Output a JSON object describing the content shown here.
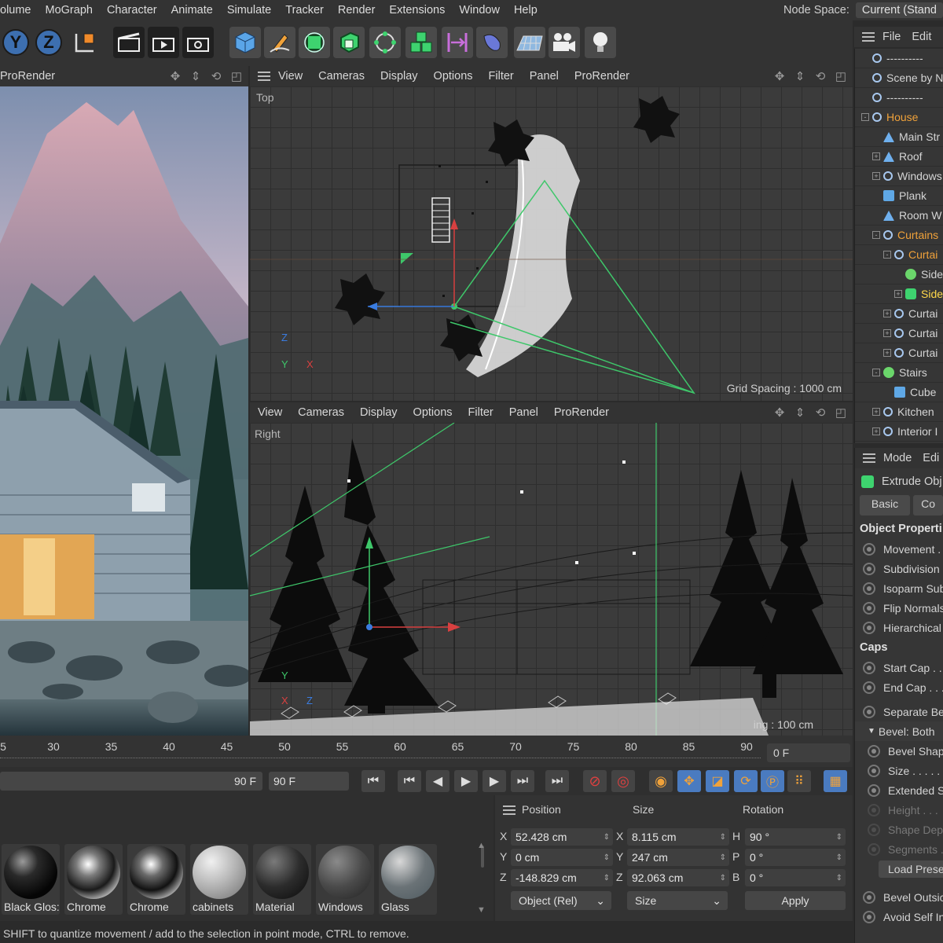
{
  "menu": [
    "olume",
    "MoGraph",
    "Character",
    "Animate",
    "Simulate",
    "Tracker",
    "Render",
    "Extensions",
    "Window",
    "Help"
  ],
  "node_space": {
    "label": "Node Space:",
    "value": "Current (Stand"
  },
  "toolbar": {
    "axis_y": "Y",
    "axis_z": "Z"
  },
  "viewport_render": {
    "header": "ProRender"
  },
  "viewport_top": {
    "menu": [
      "View",
      "Cameras",
      "Display",
      "Options",
      "Filter",
      "Panel",
      "ProRender"
    ],
    "label": "Top",
    "grid_spacing": "Grid Spacing : 1000 cm",
    "axis_z": "Z",
    "axis_y": "Y",
    "axis_x": "X"
  },
  "viewport_right": {
    "menu": [
      "View",
      "Cameras",
      "Display",
      "Options",
      "Filter",
      "Panel",
      "ProRender"
    ],
    "label": "Right",
    "grid_spacing": "ing : 100 cm",
    "axis_y": "Y",
    "axis_x": "X",
    "axis_z": "Z"
  },
  "object_manager": {
    "menu": [
      "File",
      "Edit"
    ],
    "rows": [
      {
        "name": "----------",
        "icon": "null",
        "indent": 0,
        "color": "normal"
      },
      {
        "name": "Scene by N",
        "icon": "null",
        "indent": 0,
        "color": "normal"
      },
      {
        "name": "----------",
        "icon": "null",
        "indent": 0,
        "color": "normal"
      },
      {
        "name": "House",
        "icon": "null",
        "indent": 0,
        "color": "orange",
        "expander": "-"
      },
      {
        "name": "Main Str",
        "icon": "tri",
        "indent": 1,
        "color": "normal"
      },
      {
        "name": "Roof",
        "icon": "tri",
        "indent": 1,
        "color": "normal",
        "expander": "+"
      },
      {
        "name": "Windows",
        "icon": "null",
        "indent": 1,
        "color": "normal",
        "expander": "+"
      },
      {
        "name": "Plank",
        "icon": "cube",
        "indent": 1,
        "color": "normal"
      },
      {
        "name": "Room W",
        "icon": "tri",
        "indent": 1,
        "color": "normal"
      },
      {
        "name": "Curtains",
        "icon": "null",
        "indent": 1,
        "color": "orange",
        "expander": "-"
      },
      {
        "name": "Curtai",
        "icon": "null",
        "indent": 2,
        "color": "orange",
        "expander": "-"
      },
      {
        "name": "Side",
        "icon": "greenstar",
        "indent": 3,
        "color": "normal"
      },
      {
        "name": "Side",
        "icon": "green",
        "indent": 3,
        "color": "yellow",
        "expander": "+"
      },
      {
        "name": "Curtai",
        "icon": "null",
        "indent": 2,
        "color": "normal",
        "expander": "+"
      },
      {
        "name": "Curtai",
        "icon": "null",
        "indent": 2,
        "color": "normal",
        "expander": "+"
      },
      {
        "name": "Curtai",
        "icon": "null",
        "indent": 2,
        "color": "normal",
        "expander": "+"
      },
      {
        "name": "Stairs",
        "icon": "greenstar",
        "indent": 1,
        "color": "normal",
        "expander": "-"
      },
      {
        "name": "Cube",
        "icon": "cube",
        "indent": 2,
        "color": "normal"
      },
      {
        "name": "Kitchen",
        "icon": "null",
        "indent": 1,
        "color": "normal",
        "expander": "+"
      },
      {
        "name": "Interior I",
        "icon": "null",
        "indent": 1,
        "color": "normal",
        "expander": "+"
      }
    ]
  },
  "attributes": {
    "menu": [
      "Mode",
      "Edi"
    ],
    "object_type": "Extrude Obj",
    "tabs": [
      "Basic",
      "Co"
    ],
    "section_object": "Object Properti",
    "object_props": [
      "Movement . .",
      "Subdivision",
      "Isoparm Sub",
      "Flip Normals",
      "Hierarchical"
    ],
    "section_caps": "Caps",
    "caps_props": [
      "Start Cap . .",
      "End Cap . . ."
    ],
    "separate": "Separate Be",
    "bevel": "Bevel: Both",
    "bevel_props": [
      "Bevel Shap",
      "Size . . . . .",
      "Extended S"
    ],
    "bevel_dim": [
      "Height . . .",
      "Shape Dep",
      "Segments ."
    ],
    "load_preset": "Load Prese",
    "bottom_props": [
      "Bevel Outsic",
      "Avoid Self In"
    ]
  },
  "timeline": {
    "ticks": [
      "5",
      "30",
      "35",
      "40",
      "45",
      "50",
      "55",
      "60",
      "65",
      "70",
      "75",
      "80",
      "85",
      "90"
    ],
    "current_frame": "0 F"
  },
  "transport": {
    "end_a": "90 F",
    "end_b": "90 F"
  },
  "materials": [
    "Black Glos:",
    "Chrome",
    "Chrome",
    "cabinets",
    "Material",
    "Windows",
    "Glass"
  ],
  "coordinates": {
    "headers": [
      "Position",
      "Size",
      "Rotation"
    ],
    "pos_labels": [
      "X",
      "Y",
      "Z"
    ],
    "position": [
      "52.428 cm",
      "0 cm",
      "-148.829 cm"
    ],
    "size_labels": [
      "X",
      "Y",
      "Z"
    ],
    "size": [
      "8.115 cm",
      "247 cm",
      "92.063 cm"
    ],
    "rot_labels": [
      "H",
      "P",
      "B"
    ],
    "rotation": [
      "90 °",
      "0 °",
      "0 °"
    ],
    "mode": "Object (Rel)",
    "size_mode": "Size",
    "apply": "Apply"
  },
  "status": "SHIFT to quantize movement / add to the selection in point mode, CTRL to remove."
}
